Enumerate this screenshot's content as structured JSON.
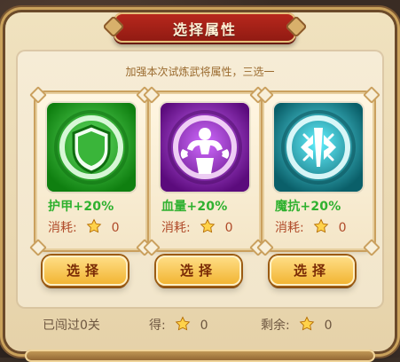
{
  "dialog": {
    "title": "选择属性",
    "subtitle": "加强本次试炼武将属性，三选一"
  },
  "cards": [
    {
      "name": "护甲",
      "bonus": "+20%",
      "cost_label": "消耗:",
      "cost_value": "0",
      "icon": "shield-icon",
      "tile_color": "#1fa51f",
      "button_label": "选择"
    },
    {
      "name": "血量",
      "bonus": "+20%",
      "cost_label": "消耗:",
      "cost_value": "0",
      "icon": "strongman-icon",
      "tile_color": "#8e1ab3",
      "button_label": "选择"
    },
    {
      "name": "魔抗",
      "bonus": "+20%",
      "cost_label": "消耗:",
      "cost_value": "0",
      "icon": "magic-resist-icon",
      "tile_color": "#1a9aa8",
      "button_label": "选择"
    }
  ],
  "footer": {
    "passed": "已闯过0关",
    "gain_label": "得:",
    "gain_value": "0",
    "remain_label": "剩余:",
    "remain_value": "0"
  },
  "colors": {
    "panel_cream": "#f2e6cb",
    "title_red": "#a72218",
    "accent_gold": "#caa05e",
    "text_green": "#2fb12f",
    "text_cost": "#b04b2a"
  }
}
